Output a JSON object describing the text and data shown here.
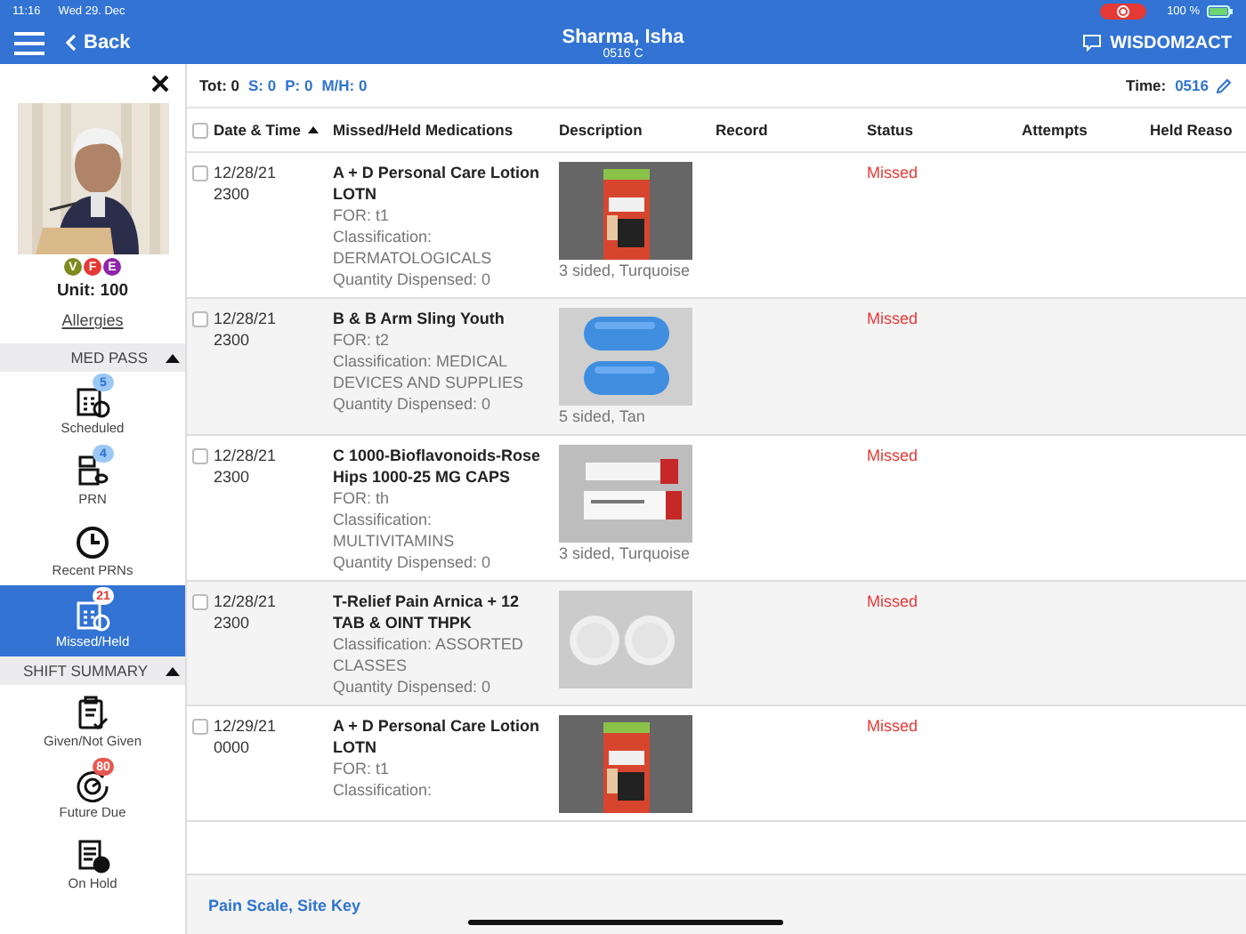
{
  "status_bar": {
    "time": "11:16",
    "date": "Wed 29. Dec",
    "battery": "100 %"
  },
  "header": {
    "back": "Back",
    "patient_name": "Sharma, Isha",
    "room": "0516 C",
    "app_name": "WISDOM2ACT"
  },
  "sidebar": {
    "badges": [
      {
        "label": "V",
        "color": "#7c8a1e"
      },
      {
        "label": "F",
        "color": "#e53935"
      },
      {
        "label": "E",
        "color": "#8e24aa"
      }
    ],
    "unit": "Unit: 100",
    "allergies": "Allergies",
    "sections": [
      {
        "title": "MED PASS",
        "expanded": true,
        "items": [
          {
            "label": "Scheduled",
            "badge": "5",
            "color": "#9cc8f5",
            "selected": false
          },
          {
            "label": "PRN",
            "badge": "4",
            "color": "#9cc8f5",
            "selected": false
          },
          {
            "label": "Recent PRNs",
            "selected": false
          },
          {
            "label": "Missed/Held",
            "badge": "21",
            "color": "#ffffff",
            "selected": true
          }
        ]
      },
      {
        "title": "SHIFT SUMMARY",
        "expanded": true,
        "items": [
          {
            "label": "Given/Not Given",
            "selected": false
          },
          {
            "label": "Future Due",
            "badge": "80",
            "color": "#e8574f",
            "selected": false
          },
          {
            "label": "On Hold",
            "selected": false
          }
        ]
      }
    ]
  },
  "summary": {
    "tot": "Tot: 0",
    "s": "S: 0",
    "p": "P: 0",
    "mh": "M/H: 0",
    "time_label": "Time:",
    "time_value": "0516"
  },
  "table": {
    "select_all_checked": false,
    "columns": [
      "Date & Time",
      "Missed/Held Medications",
      "Description",
      "Record",
      "Status",
      "Attempts",
      "Held Reaso"
    ],
    "rows": [
      {
        "checked": false,
        "date": "12/28/21",
        "time": "2300",
        "name": "A + D Personal Care Lotion LOTN",
        "details": [
          "FOR: t1",
          "Classification: DERMATOLOGICALS",
          "Quantity Dispensed: 0"
        ],
        "description": "3 sided, Turquoise",
        "status": "Missed"
      },
      {
        "checked": false,
        "date": "12/28/21",
        "time": "2300",
        "name": "B & B Arm Sling Youth",
        "details": [
          "FOR: t2",
          "Classification: MEDICAL DEVICES AND SUPPLIES",
          "Quantity Dispensed: 0"
        ],
        "description": "5 sided, Tan",
        "status": "Missed"
      },
      {
        "checked": false,
        "date": "12/28/21",
        "time": "2300",
        "name": "C 1000-Bioflavonoids-Rose Hips 1000-25 MG CAPS",
        "details": [
          "FOR: th",
          "Classification: MULTIVITAMINS",
          "Quantity Dispensed: 0"
        ],
        "description": "3 sided, Turquoise",
        "status": "Missed"
      },
      {
        "checked": false,
        "date": "12/28/21",
        "time": "2300",
        "name": "T-Relief Pain Arnica + 12 TAB & OINT THPK",
        "details": [
          "Classification: ASSORTED CLASSES",
          "Quantity Dispensed: 0"
        ],
        "status": "Missed"
      },
      {
        "checked": false,
        "date": "12/29/21",
        "time": "0000",
        "name": "A + D Personal Care Lotion LOTN",
        "details": [
          "FOR: t1",
          "Classification:"
        ],
        "status": "Missed"
      }
    ]
  },
  "footer": {
    "link": "Pain Scale, Site Key"
  }
}
